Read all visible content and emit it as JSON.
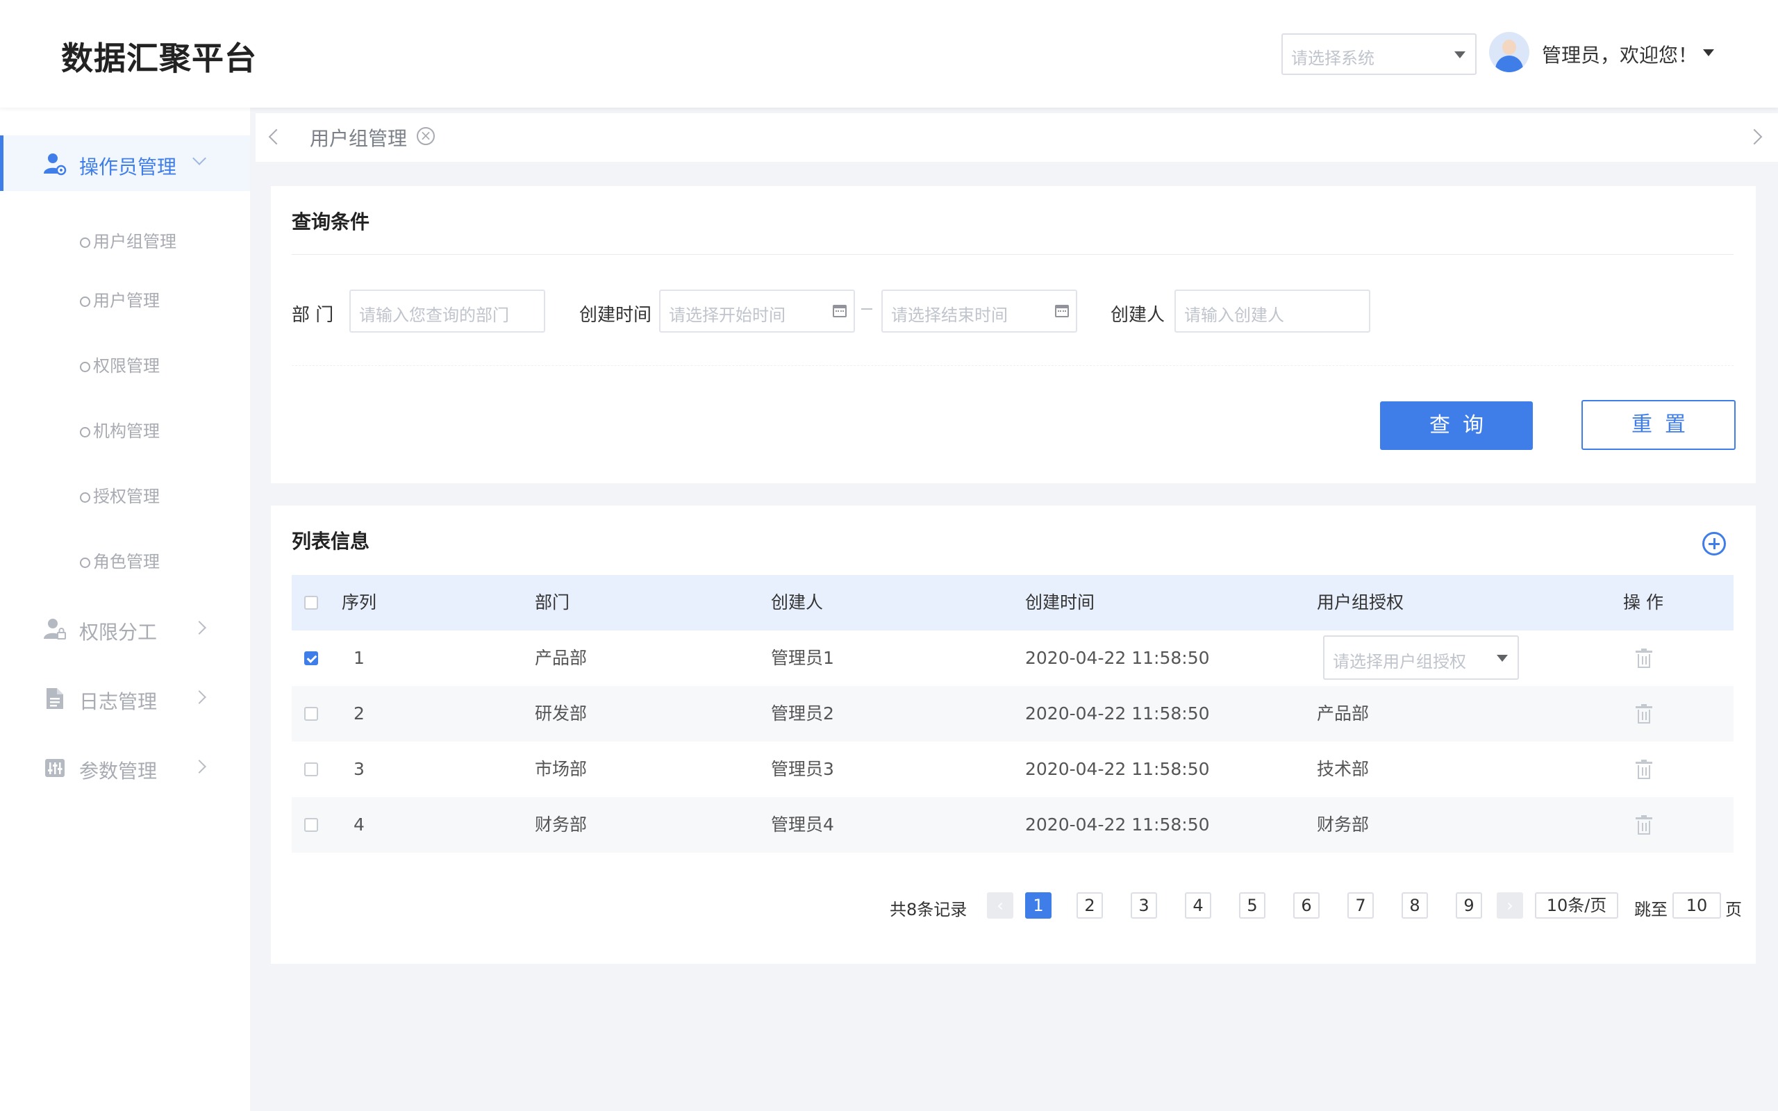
{
  "app": {
    "title": "数据汇聚平台"
  },
  "header": {
    "system_select_placeholder": "请选择系统",
    "user_greeting": "管理员，欢迎您！"
  },
  "sidebar": {
    "groups": [
      {
        "label": "操作员管理",
        "icon": "operator-icon",
        "expanded": true
      },
      {
        "label": "权限分工",
        "icon": "permission-division-icon",
        "expanded": false
      },
      {
        "label": "日志管理",
        "icon": "log-document-icon",
        "expanded": false
      },
      {
        "label": "参数管理",
        "icon": "parameter-sliders-icon",
        "expanded": false
      }
    ],
    "sub_items": [
      "用户组管理",
      "用户管理",
      "权限管理",
      "机构管理",
      "授权管理",
      "角色管理"
    ]
  },
  "tabs": {
    "items": [
      {
        "label": "用户组管理",
        "closable": true
      }
    ]
  },
  "query": {
    "title": "查询条件",
    "dept_label": "部 门",
    "dept_placeholder": "请输入您查询的部门",
    "time_label": "创建时间",
    "start_placeholder": "请选择开始时间",
    "end_placeholder": "请选择结束时间",
    "creator_label": "创建人",
    "creator_placeholder": "请输入创建人",
    "search_label": "查询",
    "reset_label": "重置"
  },
  "list": {
    "title": "列表信息",
    "columns": [
      "序列",
      "部门",
      "创建人",
      "创建时间",
      "用户组授权",
      "操 作"
    ],
    "rows": [
      {
        "index": "1",
        "dept": "产品部",
        "creator": "管理员1",
        "created": "2020-04-22 11:58:50",
        "auth": "",
        "auth_placeholder": "请选择用户组授权",
        "checked": true
      },
      {
        "index": "2",
        "dept": "研发部",
        "creator": "管理员2",
        "created": "2020-04-22 11:58:50",
        "auth": "产品部",
        "checked": false
      },
      {
        "index": "3",
        "dept": "市场部",
        "creator": "管理员3",
        "created": "2020-04-22 11:58:50",
        "auth": "技术部",
        "checked": false
      },
      {
        "index": "4",
        "dept": "财务部",
        "creator": "管理员4",
        "created": "2020-04-22 11:58:50",
        "auth": "财务部",
        "checked": false
      }
    ]
  },
  "pagination": {
    "total_text": "共8条记录",
    "pages": [
      "1",
      "2",
      "3",
      "4",
      "5",
      "6",
      "7",
      "8",
      "9"
    ],
    "current_page": "1",
    "page_size": "10条/页",
    "jump_label": "跳至",
    "jump_value": "10",
    "page_suffix": "页"
  },
  "colors": {
    "primary": "#3f7ee8",
    "table_header": "#e8f0fd"
  }
}
